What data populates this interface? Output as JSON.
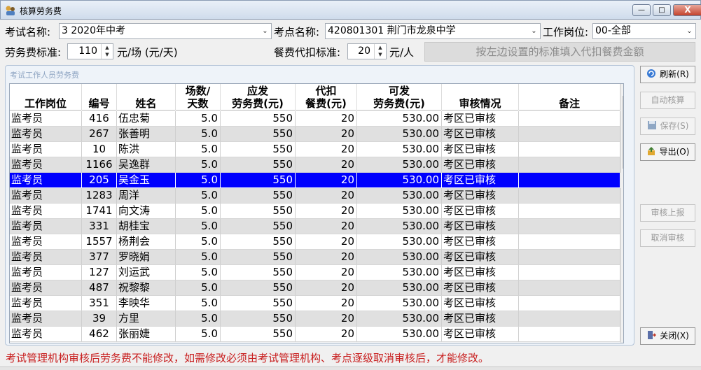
{
  "window": {
    "title": "核算劳务费",
    "min": "—",
    "max": "□",
    "close": "X"
  },
  "form": {
    "exam_label": "考试名称:",
    "exam_value": "3  2020年中考",
    "site_label": "考点名称:",
    "site_value": "420801301 荆门市龙泉中学",
    "post_label": "工作岗位:",
    "post_value": "00-全部",
    "fee_label": "劳务费标准:",
    "fee_value": "110",
    "fee_unit": "元/场 (元/天)",
    "meal_label": "餐费代扣标准:",
    "meal_value": "20",
    "meal_unit": "元/人",
    "fill_button": "按左边设置的标准填入代扣餐费金额"
  },
  "group": {
    "title": "考试工作人员劳务费",
    "headers": [
      [
        "工作岗位"
      ],
      [
        "编号"
      ],
      [
        "姓名"
      ],
      [
        "场数/",
        "天数"
      ],
      [
        "应发",
        "劳务费(元)"
      ],
      [
        "代扣",
        "餐费(元)"
      ],
      [
        "可发",
        "劳务费(元)"
      ],
      [
        "审核情况"
      ],
      [
        "备注"
      ]
    ],
    "rows": [
      [
        "监考员",
        "416",
        "伍忠菊",
        "5.0",
        "550",
        "20",
        "530.00",
        "考区已审核",
        ""
      ],
      [
        "监考员",
        "267",
        "张善明",
        "5.0",
        "550",
        "20",
        "530.00",
        "考区已审核",
        ""
      ],
      [
        "监考员",
        "10",
        "陈洪",
        "5.0",
        "550",
        "20",
        "530.00",
        "考区已审核",
        ""
      ],
      [
        "监考员",
        "1166",
        "吴逸群",
        "5.0",
        "550",
        "20",
        "530.00",
        "考区已审核",
        ""
      ],
      [
        "监考员",
        "205",
        "吴金玉",
        "5.0",
        "550",
        "20",
        "530.00",
        "考区已审核",
        ""
      ],
      [
        "监考员",
        "1283",
        "周洋",
        "5.0",
        "550",
        "20",
        "530.00",
        "考区已审核",
        ""
      ],
      [
        "监考员",
        "1741",
        "向文涛",
        "5.0",
        "550",
        "20",
        "530.00",
        "考区已审核",
        ""
      ],
      [
        "监考员",
        "331",
        "胡桂宝",
        "5.0",
        "550",
        "20",
        "530.00",
        "考区已审核",
        ""
      ],
      [
        "监考员",
        "1557",
        "杨荆会",
        "5.0",
        "550",
        "20",
        "530.00",
        "考区已审核",
        ""
      ],
      [
        "监考员",
        "377",
        "罗晓娟",
        "5.0",
        "550",
        "20",
        "530.00",
        "考区已审核",
        ""
      ],
      [
        "监考员",
        "127",
        "刘运武",
        "5.0",
        "550",
        "20",
        "530.00",
        "考区已审核",
        ""
      ],
      [
        "监考员",
        "487",
        "祝黎黎",
        "5.0",
        "550",
        "20",
        "530.00",
        "考区已审核",
        ""
      ],
      [
        "监考员",
        "351",
        "李映华",
        "5.0",
        "550",
        "20",
        "530.00",
        "考区已审核",
        ""
      ],
      [
        "监考员",
        "39",
        "方里",
        "5.0",
        "550",
        "20",
        "530.00",
        "考区已审核",
        ""
      ],
      [
        "监考员",
        "462",
        "张丽婕",
        "5.0",
        "550",
        "20",
        "530.00",
        "考区已审核",
        ""
      ]
    ],
    "selected_row": 4
  },
  "buttons": {
    "refresh": "刷新(R)",
    "auto_calc": "自动核算",
    "save": "保存(S)",
    "export": "导出(O)",
    "submit": "审核上报",
    "cancel_review": "取消审核",
    "close": "关闭(X)"
  },
  "footer": "考试管理机构审核后劳务费不能修改，如需修改必须由考试管理机构、考点逐级取消审核后，才能修改。",
  "colors": {
    "selected_row": "#0000fe",
    "footer_text": "#c81e1e",
    "alt_row": "#e0e0e0"
  }
}
